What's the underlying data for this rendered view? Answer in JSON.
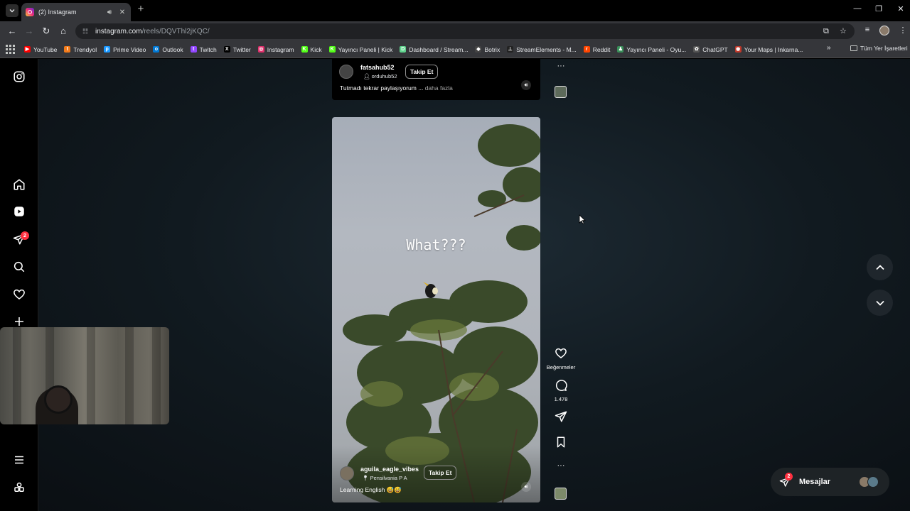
{
  "browser": {
    "tab": {
      "title": "(2) Instagram"
    },
    "new_tab_label": "+",
    "url_host": "instagram.com",
    "url_path": "/reels/DQVThl2jKQC/",
    "bookmarks": [
      {
        "label": "YouTube",
        "color": "#ff0000",
        "glyph": "▶"
      },
      {
        "label": "Trendyol",
        "color": "#f27a1a",
        "glyph": "t"
      },
      {
        "label": "Prime Video",
        "color": "#1a98ff",
        "glyph": "p"
      },
      {
        "label": "Outlook",
        "color": "#0078d4",
        "glyph": "o"
      },
      {
        "label": "Twitch",
        "color": "#9146ff",
        "glyph": "t"
      },
      {
        "label": "Twitter",
        "color": "#000000",
        "glyph": "X"
      },
      {
        "label": "Instagram",
        "color": "#e1306c",
        "glyph": "◎"
      },
      {
        "label": "Kick",
        "color": "#53fc18",
        "glyph": "K"
      },
      {
        "label": "Yayıncı Paneli | Kick",
        "color": "#53fc18",
        "glyph": "K"
      },
      {
        "label": "Dashboard / Stream...",
        "color": "#5fd38d",
        "glyph": "D"
      },
      {
        "label": "Botrix",
        "color": "#444444",
        "glyph": "◆"
      },
      {
        "label": "StreamElements - M...",
        "color": "#222222",
        "glyph": "⊥"
      },
      {
        "label": "Reddit",
        "color": "#ff4500",
        "glyph": "r"
      },
      {
        "label": "Yayıncı Paneli - Oyu...",
        "color": "#3a8f5a",
        "glyph": "♟"
      },
      {
        "label": "ChatGPT",
        "color": "#555555",
        "glyph": "✿"
      },
      {
        "label": "Your Maps | Inkarna...",
        "color": "#c0392b",
        "glyph": "◉"
      }
    ],
    "all_bookmarks_label": "Tüm Yer İşaretleri"
  },
  "post_top": {
    "username": "fatsahub52",
    "subinfo": "orduhub52",
    "follow_label": "Takip Et",
    "caption": "Tutmadı tekrar paylaşıyorum ...",
    "more_label": "daha fazla"
  },
  "reel": {
    "overlay_text": "What???",
    "username": "aguila_eagle_vibes",
    "location": "Pensilvania P A",
    "follow_label": "Takip Et",
    "caption": "Learning English 😅😅"
  },
  "actions": {
    "likes_label": "Beğenmeler",
    "comments_count": "1.478",
    "more_glyph": "···"
  },
  "sidebar": {
    "notifications_badge": "2"
  },
  "messages": {
    "label": "Mesajlar",
    "badge": "2"
  }
}
